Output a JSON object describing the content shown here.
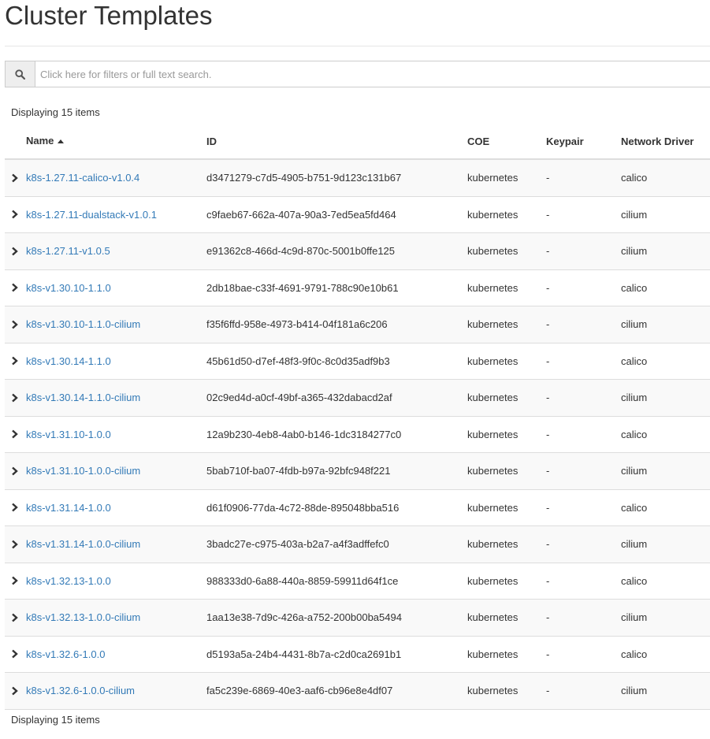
{
  "page": {
    "title": "Cluster Templates"
  },
  "search": {
    "placeholder": "Click here for filters or full text search.",
    "icon": "search-icon"
  },
  "count_top": "Displaying 15 items",
  "count_bottom": "Displaying 15 items",
  "table": {
    "columns": {
      "name": "Name",
      "id": "ID",
      "coe": "COE",
      "keypair": "Keypair",
      "network_driver": "Network Driver"
    },
    "sort_column": "Name",
    "sort_direction": "ascending",
    "rows": [
      {
        "name": "k8s-1.27.11-calico-v1.0.4",
        "id": "d3471279-c7d5-4905-b751-9d123c131b67",
        "coe": "kubernetes",
        "keypair": "-",
        "network_driver": "calico"
      },
      {
        "name": "k8s-1.27.11-dualstack-v1.0.1",
        "id": "c9faeb67-662a-407a-90a3-7ed5ea5fd464",
        "coe": "kubernetes",
        "keypair": "-",
        "network_driver": "cilium"
      },
      {
        "name": "k8s-1.27.11-v1.0.5",
        "id": "e91362c8-466d-4c9d-870c-5001b0ffe125",
        "coe": "kubernetes",
        "keypair": "-",
        "network_driver": "cilium"
      },
      {
        "name": "k8s-v1.30.10-1.1.0",
        "id": "2db18bae-c33f-4691-9791-788c90e10b61",
        "coe": "kubernetes",
        "keypair": "-",
        "network_driver": "calico"
      },
      {
        "name": "k8s-v1.30.10-1.1.0-cilium",
        "id": "f35f6ffd-958e-4973-b414-04f181a6c206",
        "coe": "kubernetes",
        "keypair": "-",
        "network_driver": "cilium"
      },
      {
        "name": "k8s-v1.30.14-1.1.0",
        "id": "45b61d50-d7ef-48f3-9f0c-8c0d35adf9b3",
        "coe": "kubernetes",
        "keypair": "-",
        "network_driver": "calico"
      },
      {
        "name": "k8s-v1.30.14-1.1.0-cilium",
        "id": "02c9ed4d-a0cf-49bf-a365-432dabacd2af",
        "coe": "kubernetes",
        "keypair": "-",
        "network_driver": "cilium"
      },
      {
        "name": "k8s-v1.31.10-1.0.0",
        "id": "12a9b230-4eb8-4ab0-b146-1dc3184277c0",
        "coe": "kubernetes",
        "keypair": "-",
        "network_driver": "calico"
      },
      {
        "name": "k8s-v1.31.10-1.0.0-cilium",
        "id": "5bab710f-ba07-4fdb-b97a-92bfc948f221",
        "coe": "kubernetes",
        "keypair": "-",
        "network_driver": "cilium"
      },
      {
        "name": "k8s-v1.31.14-1.0.0",
        "id": "d61f0906-77da-4c72-88de-895048bba516",
        "coe": "kubernetes",
        "keypair": "-",
        "network_driver": "calico"
      },
      {
        "name": "k8s-v1.31.14-1.0.0-cilium",
        "id": "3badc27e-c975-403a-b2a7-a4f3adffefc0",
        "coe": "kubernetes",
        "keypair": "-",
        "network_driver": "cilium"
      },
      {
        "name": "k8s-v1.32.13-1.0.0",
        "id": "988333d0-6a88-440a-8859-59911d64f1ce",
        "coe": "kubernetes",
        "keypair": "-",
        "network_driver": "calico"
      },
      {
        "name": "k8s-v1.32.13-1.0.0-cilium",
        "id": "1aa13e38-7d9c-426a-a752-200b00ba5494",
        "coe": "kubernetes",
        "keypair": "-",
        "network_driver": "cilium"
      },
      {
        "name": "k8s-v1.32.6-1.0.0",
        "id": "d5193a5a-24b4-4431-8b7a-c2d0ca2691b1",
        "coe": "kubernetes",
        "keypair": "-",
        "network_driver": "calico"
      },
      {
        "name": "k8s-v1.32.6-1.0.0-cilium",
        "id": "fa5c239e-6869-40e3-aaf6-cb96e8e4df07",
        "coe": "kubernetes",
        "keypair": "-",
        "network_driver": "cilium"
      }
    ]
  },
  "colors": {
    "link": "#337ab7",
    "text": "#333333",
    "stripe": "#f9f9f9",
    "border": "#dddddd"
  }
}
